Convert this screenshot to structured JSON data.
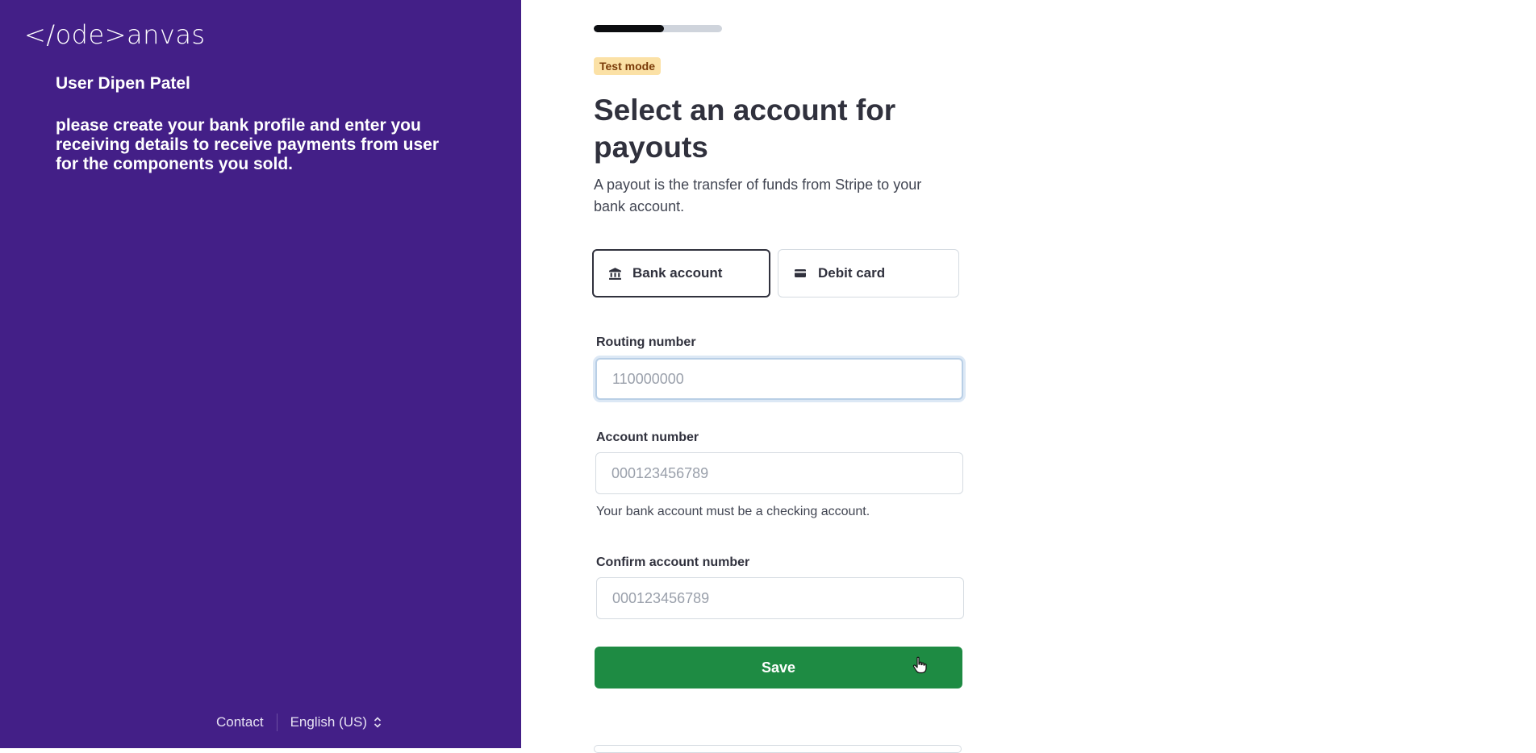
{
  "left_panel": {
    "logo_text": "</ode>anvas",
    "user_name": "User Dipen Patel",
    "instructions": "please create your bank profile and enter you receiving details to receive payments from user for the components you sold.",
    "footer": {
      "contact_label": "Contact",
      "language_label": "English (US)"
    }
  },
  "form": {
    "progress_fraction": 0.55,
    "badge": "Test mode",
    "title": "Select an account for payouts",
    "description": "A payout is the transfer of funds from Stripe to your bank account.",
    "methods": [
      {
        "label": "Bank account",
        "icon": "bank-icon",
        "selected": true
      },
      {
        "label": "Debit card",
        "icon": "card-icon",
        "selected": false
      }
    ],
    "routing": {
      "label": "Routing number",
      "placeholder": "110000000",
      "value": ""
    },
    "account": {
      "label": "Account number",
      "placeholder": "000123456789",
      "value": "",
      "hint": "Your bank account must be a checking account."
    },
    "confirm": {
      "label": "Confirm account number",
      "placeholder": "000123456789",
      "value": ""
    },
    "save_label": "Save"
  },
  "colors": {
    "panel_bg": "#431f87",
    "save_bg": "#1e8b43",
    "badge_bg": "#fbe1a6",
    "badge_text": "#7a3b08"
  }
}
